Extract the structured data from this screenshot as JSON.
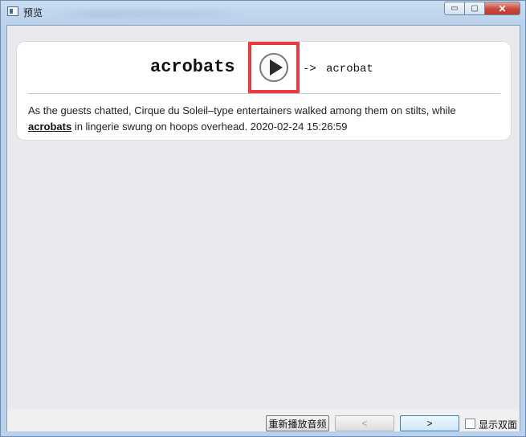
{
  "window": {
    "title": "预览",
    "controls": {
      "minimize": "▭",
      "maximize": "▢",
      "close": "✕"
    }
  },
  "card": {
    "word": "acrobats",
    "play_icon": "play-icon",
    "arrow": "->",
    "lemma": "acrobat",
    "sentence_before": "As the guests chatted, Cirque du Soleil–type entertainers walked among them on stilts, while ",
    "sentence_highlight": "acrobats",
    "sentence_after": " in lingerie swung on hoops overhead. 2020-02-24 15:26:59"
  },
  "bottombar": {
    "replay_label": "重新播放音频",
    "prev_label": "<",
    "next_label": ">",
    "double_side_label": "显示双面",
    "double_side_checked": false
  },
  "colors": {
    "accent_frame": "#ea3a3f",
    "client_bg": "#e9eaed"
  }
}
